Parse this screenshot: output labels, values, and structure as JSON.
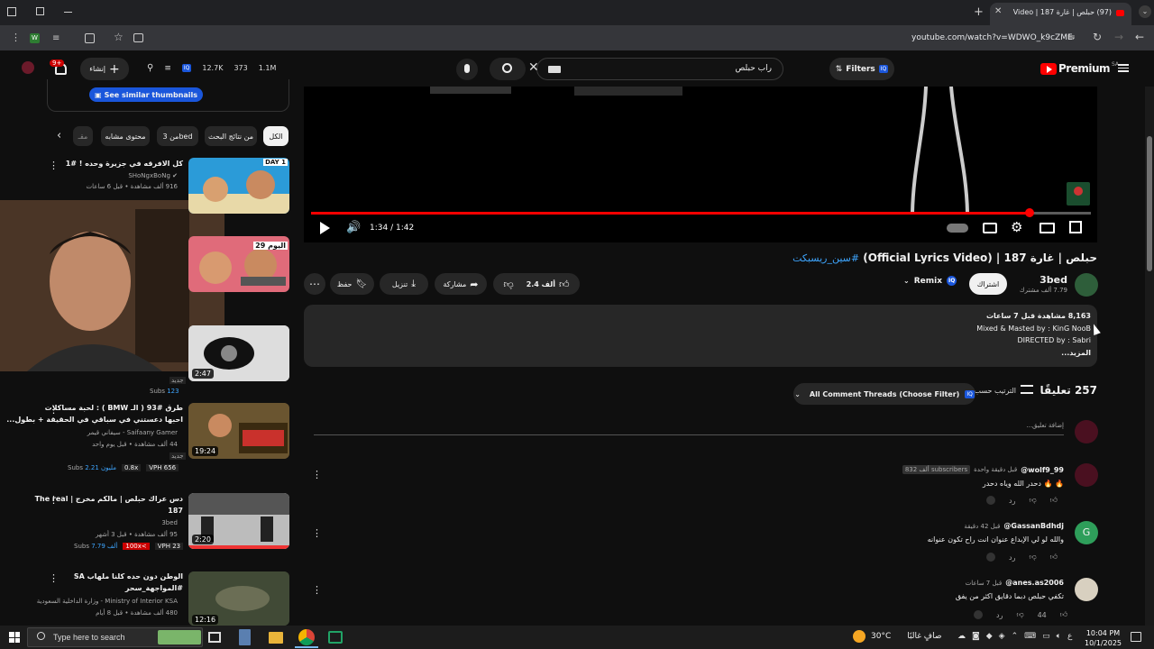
{
  "browser": {
    "tab_title": "(97) حبلص | غارة 187 | Video",
    "url": "youtube.com/watch?v=WDWO_k9cZME"
  },
  "header": {
    "logo": "Premium",
    "logo_region": "SA",
    "search_value": "راب حبلص",
    "filters_label": "Filters",
    "create_label": "إنشاء",
    "notif_count": "9+",
    "ext_stats": [
      "12.7K",
      "373",
      "1.1M"
    ]
  },
  "video": {
    "title": "حبلص | غارة 187 | (Official Lyrics Video)",
    "hashtag": "#سين_ريسبكت",
    "time": "1:34 / 1:42",
    "progress": 0.92,
    "channel": "3bed",
    "subs": "7.79 ألف مشترك",
    "subscribe": "اشتراك",
    "remix": "Remix",
    "likes": "2.4 ألف",
    "share": "مشاركة",
    "download": "تنزيل",
    "save": "حفظ"
  },
  "description": {
    "stats": "8,163 مشاهدة قبل 7 ساعات",
    "line1": "Mixed & Masted by :  KinG NooB",
    "line2": "DIRECTED by : Sabri",
    "more": "...المزيد"
  },
  "comments": {
    "count": "257 تعليقًا",
    "sort": "الترتيب حسب",
    "filter": "All Comment Threads (Choose Filter)",
    "add": "إضافة تعليق...",
    "items": [
      {
        "name": "@wolf9_99",
        "time": "قبل دقيقة واحدة",
        "subs": "832 ألف subscribers",
        "text": "🔥 🔥 دحدر الله وياه دحدر",
        "reply": "رد",
        "likes": ""
      },
      {
        "name": "@GassanBdhdj",
        "time": "قبل 42 دقيقة",
        "subs": "",
        "text": "والله لو لي الإبداع عنوان انت راح تكون  عنوانه",
        "reply": "رد",
        "likes": "",
        "initial": "G"
      },
      {
        "name": "@anes.as2006",
        "time": "قبل 7 ساعات",
        "subs": "",
        "text": "تكفي حبلص دبما دقايق اكثر من يفق",
        "reply": "رد",
        "likes": "44"
      }
    ]
  },
  "sidebar": {
    "see_similar": "See similar thumbnails",
    "chips": [
      "الكل",
      "من نتائج البحث",
      "من 3bed",
      "محتوى مشابه",
      "مقـ"
    ],
    "items": [
      {
        "title": "كل الافرقه في جزيرة وحده ! #1",
        "channel": "SHoNgxBoNg",
        "meta": "916 ألف مشاهدة • قبل 6 ساعات",
        "badge": "DAY 1"
      },
      {
        "title": "",
        "channel": "",
        "meta": "",
        "badge": "اليوم 29"
      },
      {
        "title": "",
        "channel": "",
        "meta": "",
        "duration": "2:47",
        "subs": "123",
        "subs_label": "Subs",
        "new": "جديد"
      },
      {
        "title": "طرق #93 ( الـ BMW ) : لحبة مساكلات",
        "title2": "احبها دعستني في سباقي في الحقيقة + بطول...",
        "channel": "سيفاني قيمر - Saifaany Gamer",
        "meta": "44 ألف مشاهدة • قبل يوم واحد",
        "new": "جديد",
        "duration": "19:24",
        "subs": "2.21 مليون",
        "subs_label": "Subs",
        "ratio": "0.8x",
        "vph": "VPH 656"
      },
      {
        "title": "دس عراك حبلص  | مالكم مخرج | The real",
        "title2": "187",
        "channel": "3bed",
        "meta": "95 ألف مشاهدة • قبل 3 أشهر",
        "duration": "2:20",
        "subs": "7.79 ألف",
        "subs_label": "Subs",
        "ratio": "100x<",
        "vph": "VPH 23"
      },
      {
        "title": "الوطن دون حده كلنا ملهاب SA",
        "title2": "#المواجهة_سحر",
        "channel": "وزارة الداخلية السعودية - Ministry of Interior KSA",
        "meta": "480 ألف مشاهدة • قبل 8 أيام",
        "duration": "12:16"
      }
    ]
  },
  "taskbar": {
    "search_placeholder": "Type here to search",
    "weather": "30°C",
    "weather_desc": "صافٍ غالبًا",
    "time": "10:04 PM",
    "date": "10/1/2025",
    "lang": "ع"
  },
  "colors": {
    "accent": "#ff0000",
    "link": "#3ea6ff",
    "bg": "#0f0f0f",
    "chip": "#272727"
  }
}
